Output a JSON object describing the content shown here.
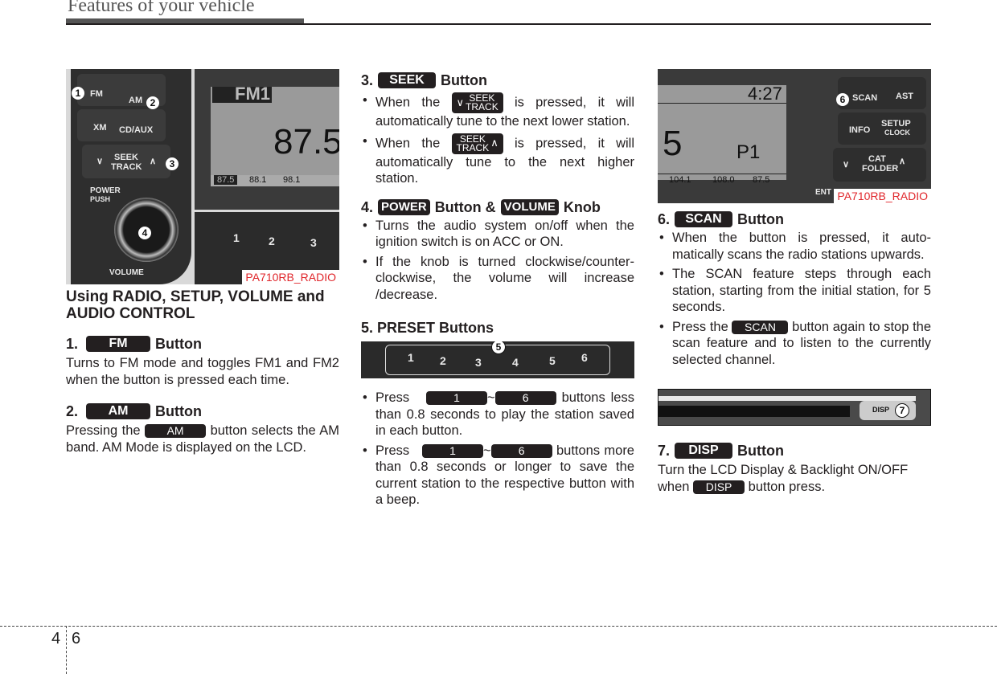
{
  "header": {
    "title": "Features of your vehicle"
  },
  "footer": {
    "chapter": "4",
    "page": "6"
  },
  "photo1": {
    "ref": "PA710RB_RADIO",
    "buttons": [
      "FM",
      "AM",
      "XM",
      "CD/AUX",
      "SEEK",
      "TRACK",
      "POWER",
      "PUSH",
      "VOLUME"
    ],
    "lcd": {
      "band": "FM1",
      "freq": "87.5",
      "presets": [
        "87.5",
        "88.1",
        "98.1"
      ]
    },
    "preset_keys": [
      "1",
      "2",
      "3"
    ],
    "callouts": [
      "1",
      "2",
      "3",
      "4"
    ]
  },
  "col1": {
    "heading": "Using RADIO, SETUP, VOLUME and AUDIO CONTROL",
    "s1": {
      "num": "1.",
      "pill": "FM",
      "suffix": "Button",
      "text": "Turns to FM mode and toggles FM1 and FM2 when the button is pressed each time."
    },
    "s2": {
      "num": "2.",
      "pill": "AM",
      "suffix": "Button",
      "text_a": "Pressing the",
      "inline_pill": "AM",
      "text_b": "button selects the AM band. AM Mode is displayed on the LCD."
    }
  },
  "col2": {
    "s3": {
      "num": "3.",
      "pill": "SEEK",
      "suffix": "Button",
      "b1_a": "When the",
      "b1_b": "is pressed, it will automatically tune to the next lower station.",
      "b2_a": "When the",
      "b2_b": "is pressed, it will automatically tune to the next higher station.",
      "seek_top": "SEEK",
      "seek_bottom": "TRACK"
    },
    "s4": {
      "num": "4.",
      "pill1": "POWER",
      "mid": "Button &",
      "pill2": "VOLUME",
      "suffix": "Knob",
      "b1": "Turns the audio system on/off when the ignition switch is on ACC or ON.",
      "b2": "If the knob is turned clockwise/counter-clockwise, the volume will increase /decrease."
    },
    "s5": {
      "heading": "5. PRESET Buttons",
      "keys": [
        "1",
        "2",
        "3",
        "4",
        "5",
        "6"
      ],
      "callout": "5",
      "b1_a": "Press",
      "pill_from": "1",
      "tilde": "~",
      "pill_to": "6",
      "b1_b": "buttons less than 0.8 seconds to play the station saved in each button.",
      "b2_a": "Press",
      "b2_b": "buttons more than 0.8 seconds or longer to save the current station to the respective button with a beep."
    }
  },
  "photo2": {
    "ref": "PA710RB_RADIO",
    "lcd": {
      "time": "4:27",
      "freq_tail": "5",
      "preset": "P1",
      "presets": [
        "104.1",
        "108.0",
        "87.5"
      ]
    },
    "buttons": [
      "SCAN",
      "AST",
      "INFO",
      "SETUP",
      "CLOCK",
      "CAT",
      "FOLDER",
      "ENT"
    ],
    "callout": "6"
  },
  "col3": {
    "s6": {
      "num": "6.",
      "pill": "SCAN",
      "suffix": "Button",
      "b1": "When the button is pressed, it auto-matically scans the radio stations upwards.",
      "b2": "The SCAN feature steps through each station, starting from the initial station, for 5 seconds.",
      "b3_a": "Press the",
      "b3_pill": "SCAN",
      "b3_b": "button again to stop the scan feature and to listen to the currently selected channel."
    },
    "photo3": {
      "button": "DISP",
      "callout": "7"
    },
    "s7": {
      "num": "7.",
      "pill": "DISP",
      "suffix": "Button",
      "text_a": "Turn the LCD Display & Backlight ON/OFF when",
      "inline_pill": "DISP",
      "text_b": "button press."
    }
  }
}
